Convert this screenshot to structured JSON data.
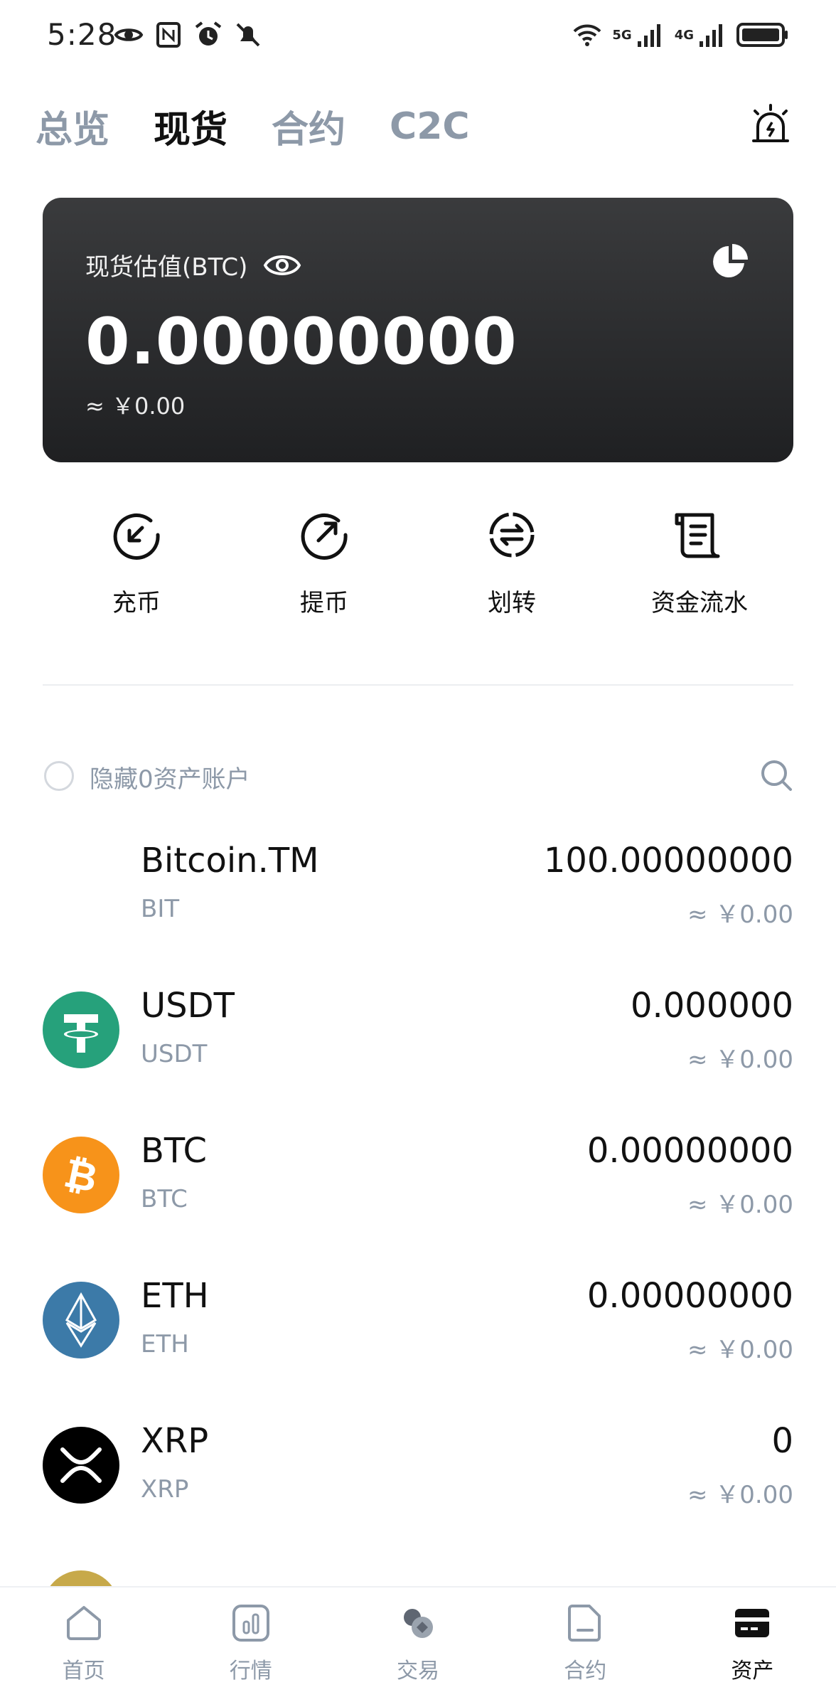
{
  "status_bar": {
    "time": "5:28",
    "icons": [
      "eye-icon",
      "nfc-icon",
      "alarm-icon",
      "mute-icon",
      "wifi-icon",
      "5g-signal-icon",
      "4g-signal-icon",
      "battery-icon"
    ],
    "net1": "5G",
    "net2": "4G"
  },
  "top_tabs": [
    {
      "label": "总览",
      "active": false
    },
    {
      "label": "现货",
      "active": true
    },
    {
      "label": "合约",
      "active": false
    },
    {
      "label": "C2C",
      "active": false
    }
  ],
  "balance": {
    "label": "现货估值(BTC)",
    "value": "0.00000000",
    "cny": "≈ ￥0.00"
  },
  "actions": [
    {
      "label": "充币",
      "icon": "deposit-icon"
    },
    {
      "label": "提币",
      "icon": "withdraw-icon"
    },
    {
      "label": "划转",
      "icon": "transfer-icon"
    },
    {
      "label": "资金流水",
      "icon": "ledger-icon"
    }
  ],
  "filter": {
    "label": "隐藏0资产账户"
  },
  "assets": [
    {
      "name": "Bitcoin.TM",
      "symbol": "BIT",
      "amount": "100.00000000",
      "cny": "≈ ￥0.00",
      "logo": "none"
    },
    {
      "name": "USDT",
      "symbol": "USDT",
      "amount": "0.000000",
      "cny": "≈ ￥0.00",
      "logo": "usdt-logo",
      "color": "#26a17b"
    },
    {
      "name": "BTC",
      "symbol": "BTC",
      "amount": "0.00000000",
      "cny": "≈ ￥0.00",
      "logo": "btc-logo",
      "color": "#f7931a"
    },
    {
      "name": "ETH",
      "symbol": "ETH",
      "amount": "0.00000000",
      "cny": "≈ ￥0.00",
      "logo": "eth-logo",
      "color": "#3c7aa8"
    },
    {
      "name": "XRP",
      "symbol": "XRP",
      "amount": "0",
      "cny": "≈ ￥0.00",
      "logo": "xrp-logo",
      "color": "#000000"
    }
  ],
  "bottom_nav": [
    {
      "label": "首页",
      "icon": "home-icon",
      "active": false
    },
    {
      "label": "行情",
      "icon": "market-icon",
      "active": false
    },
    {
      "label": "交易",
      "icon": "trade-icon",
      "active": false
    },
    {
      "label": "合约",
      "icon": "contract-icon",
      "active": false
    },
    {
      "label": "资产",
      "icon": "wallet-icon",
      "active": true
    }
  ]
}
